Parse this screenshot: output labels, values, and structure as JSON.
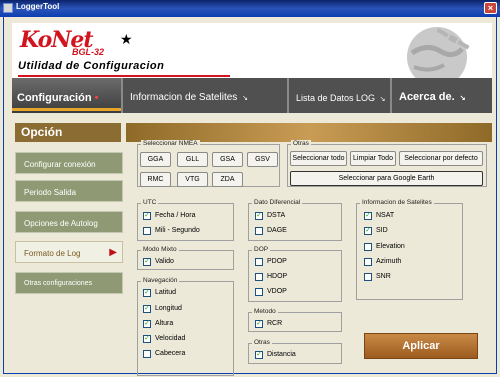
{
  "window": {
    "title": "LoggerTool",
    "close": "×"
  },
  "header": {
    "logo_word": "KoNet",
    "logo_model": "BGL-32",
    "title": "Utilidad de Configuracion"
  },
  "tabs": [
    {
      "label": "Configuración",
      "marker": "•"
    },
    {
      "label": "Informacion de Satelites",
      "marker": "↘"
    },
    {
      "label": "Lista de Datos LOG",
      "marker": "↘"
    },
    {
      "label": "Acerca de.",
      "marker": "↘"
    }
  ],
  "option_header": "Opción",
  "sidebar": [
    {
      "label": "Configurar conexión"
    },
    {
      "label": "Periodo Salida"
    },
    {
      "label": "Opciones de Autolog"
    },
    {
      "label": "Formato de Log",
      "arrow": "▶"
    },
    {
      "label": "Otras configuraciones"
    }
  ],
  "nmea": {
    "legend": "Seleccionar NMEA",
    "buttons": [
      "GGA",
      "GLL",
      "GSA",
      "GSV",
      "RMC",
      "VTG",
      "ZDA"
    ]
  },
  "otras": {
    "legend": "Otras",
    "select_all": "Seleccionar todo",
    "clear_all": "Limpiar Todo",
    "select_default": "Seleccionar por defecto",
    "google_earth": "Seleccionar para Google Earth"
  },
  "utc": {
    "legend": "UTC",
    "items": [
      {
        "label": "Fecha / Hora",
        "checked": true
      },
      {
        "label": "Mili - Segundo",
        "checked": false
      }
    ]
  },
  "modo_mixto": {
    "legend": "Modo Mixto",
    "items": [
      {
        "label": "Valido",
        "checked": true
      }
    ]
  },
  "navegacion": {
    "legend": "Navegación",
    "items": [
      {
        "label": "Latitud",
        "checked": true
      },
      {
        "label": "Longitud",
        "checked": true
      },
      {
        "label": "Altura",
        "checked": true
      },
      {
        "label": "Velocidad",
        "checked": true
      },
      {
        "label": "Cabecera",
        "checked": false
      }
    ]
  },
  "dato_diferencial": {
    "legend": "Dato Diferencial",
    "items": [
      {
        "label": "DSTA",
        "checked": true
      },
      {
        "label": "DAGE",
        "checked": false
      }
    ]
  },
  "dop": {
    "legend": "DOP",
    "items": [
      {
        "label": "PDOP",
        "checked": false
      },
      {
        "label": "HDOP",
        "checked": false
      },
      {
        "label": "VDOP",
        "checked": false
      }
    ]
  },
  "metodo": {
    "legend": "Metodo",
    "items": [
      {
        "label": "RCR",
        "checked": true
      }
    ]
  },
  "otras_bottom": {
    "legend": "Otras",
    "items": [
      {
        "label": "Distancia",
        "checked": true
      }
    ]
  },
  "satelites": {
    "legend": "Informacion de Satelites",
    "items": [
      {
        "label": "NSAT",
        "checked": true
      },
      {
        "label": "SID",
        "checked": true
      },
      {
        "label": "Elevation",
        "checked": false
      },
      {
        "label": "Azimuth",
        "checked": false
      },
      {
        "label": "SNR",
        "checked": false
      }
    ]
  },
  "apply_label": "Aplicar",
  "colors": {
    "accent": "#d2141e",
    "title_bar": "#0a3fb0",
    "sidebar_button": "#8f9a74",
    "tab_bar": "#505050",
    "apply_button": "#b5763a"
  }
}
